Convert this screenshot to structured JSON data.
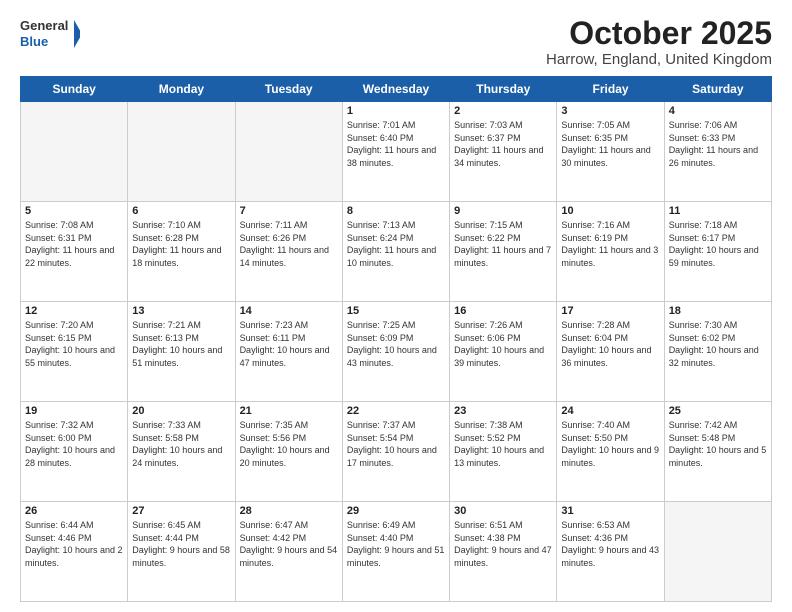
{
  "header": {
    "logo_general": "General",
    "logo_blue": "Blue",
    "title": "October 2025",
    "location": "Harrow, England, United Kingdom"
  },
  "days_of_week": [
    "Sunday",
    "Monday",
    "Tuesday",
    "Wednesday",
    "Thursday",
    "Friday",
    "Saturday"
  ],
  "weeks": [
    [
      {
        "day": "",
        "empty": true
      },
      {
        "day": "",
        "empty": true
      },
      {
        "day": "",
        "empty": true
      },
      {
        "day": "1",
        "sunrise": "7:01 AM",
        "sunset": "6:40 PM",
        "daylight": "11 hours and 38 minutes."
      },
      {
        "day": "2",
        "sunrise": "7:03 AM",
        "sunset": "6:37 PM",
        "daylight": "11 hours and 34 minutes."
      },
      {
        "day": "3",
        "sunrise": "7:05 AM",
        "sunset": "6:35 PM",
        "daylight": "11 hours and 30 minutes."
      },
      {
        "day": "4",
        "sunrise": "7:06 AM",
        "sunset": "6:33 PM",
        "daylight": "11 hours and 26 minutes."
      }
    ],
    [
      {
        "day": "5",
        "sunrise": "7:08 AM",
        "sunset": "6:31 PM",
        "daylight": "11 hours and 22 minutes."
      },
      {
        "day": "6",
        "sunrise": "7:10 AM",
        "sunset": "6:28 PM",
        "daylight": "11 hours and 18 minutes."
      },
      {
        "day": "7",
        "sunrise": "7:11 AM",
        "sunset": "6:26 PM",
        "daylight": "11 hours and 14 minutes."
      },
      {
        "day": "8",
        "sunrise": "7:13 AM",
        "sunset": "6:24 PM",
        "daylight": "11 hours and 10 minutes."
      },
      {
        "day": "9",
        "sunrise": "7:15 AM",
        "sunset": "6:22 PM",
        "daylight": "11 hours and 7 minutes."
      },
      {
        "day": "10",
        "sunrise": "7:16 AM",
        "sunset": "6:19 PM",
        "daylight": "11 hours and 3 minutes."
      },
      {
        "day": "11",
        "sunrise": "7:18 AM",
        "sunset": "6:17 PM",
        "daylight": "10 hours and 59 minutes."
      }
    ],
    [
      {
        "day": "12",
        "sunrise": "7:20 AM",
        "sunset": "6:15 PM",
        "daylight": "10 hours and 55 minutes."
      },
      {
        "day": "13",
        "sunrise": "7:21 AM",
        "sunset": "6:13 PM",
        "daylight": "10 hours and 51 minutes."
      },
      {
        "day": "14",
        "sunrise": "7:23 AM",
        "sunset": "6:11 PM",
        "daylight": "10 hours and 47 minutes."
      },
      {
        "day": "15",
        "sunrise": "7:25 AM",
        "sunset": "6:09 PM",
        "daylight": "10 hours and 43 minutes."
      },
      {
        "day": "16",
        "sunrise": "7:26 AM",
        "sunset": "6:06 PM",
        "daylight": "10 hours and 39 minutes."
      },
      {
        "day": "17",
        "sunrise": "7:28 AM",
        "sunset": "6:04 PM",
        "daylight": "10 hours and 36 minutes."
      },
      {
        "day": "18",
        "sunrise": "7:30 AM",
        "sunset": "6:02 PM",
        "daylight": "10 hours and 32 minutes."
      }
    ],
    [
      {
        "day": "19",
        "sunrise": "7:32 AM",
        "sunset": "6:00 PM",
        "daylight": "10 hours and 28 minutes."
      },
      {
        "day": "20",
        "sunrise": "7:33 AM",
        "sunset": "5:58 PM",
        "daylight": "10 hours and 24 minutes."
      },
      {
        "day": "21",
        "sunrise": "7:35 AM",
        "sunset": "5:56 PM",
        "daylight": "10 hours and 20 minutes."
      },
      {
        "day": "22",
        "sunrise": "7:37 AM",
        "sunset": "5:54 PM",
        "daylight": "10 hours and 17 minutes."
      },
      {
        "day": "23",
        "sunrise": "7:38 AM",
        "sunset": "5:52 PM",
        "daylight": "10 hours and 13 minutes."
      },
      {
        "day": "24",
        "sunrise": "7:40 AM",
        "sunset": "5:50 PM",
        "daylight": "10 hours and 9 minutes."
      },
      {
        "day": "25",
        "sunrise": "7:42 AM",
        "sunset": "5:48 PM",
        "daylight": "10 hours and 5 minutes."
      }
    ],
    [
      {
        "day": "26",
        "sunrise": "6:44 AM",
        "sunset": "4:46 PM",
        "daylight": "10 hours and 2 minutes."
      },
      {
        "day": "27",
        "sunrise": "6:45 AM",
        "sunset": "4:44 PM",
        "daylight": "9 hours and 58 minutes."
      },
      {
        "day": "28",
        "sunrise": "6:47 AM",
        "sunset": "4:42 PM",
        "daylight": "9 hours and 54 minutes."
      },
      {
        "day": "29",
        "sunrise": "6:49 AM",
        "sunset": "4:40 PM",
        "daylight": "9 hours and 51 minutes."
      },
      {
        "day": "30",
        "sunrise": "6:51 AM",
        "sunset": "4:38 PM",
        "daylight": "9 hours and 47 minutes."
      },
      {
        "day": "31",
        "sunrise": "6:53 AM",
        "sunset": "4:36 PM",
        "daylight": "9 hours and 43 minutes."
      },
      {
        "day": "",
        "empty": true
      }
    ]
  ]
}
